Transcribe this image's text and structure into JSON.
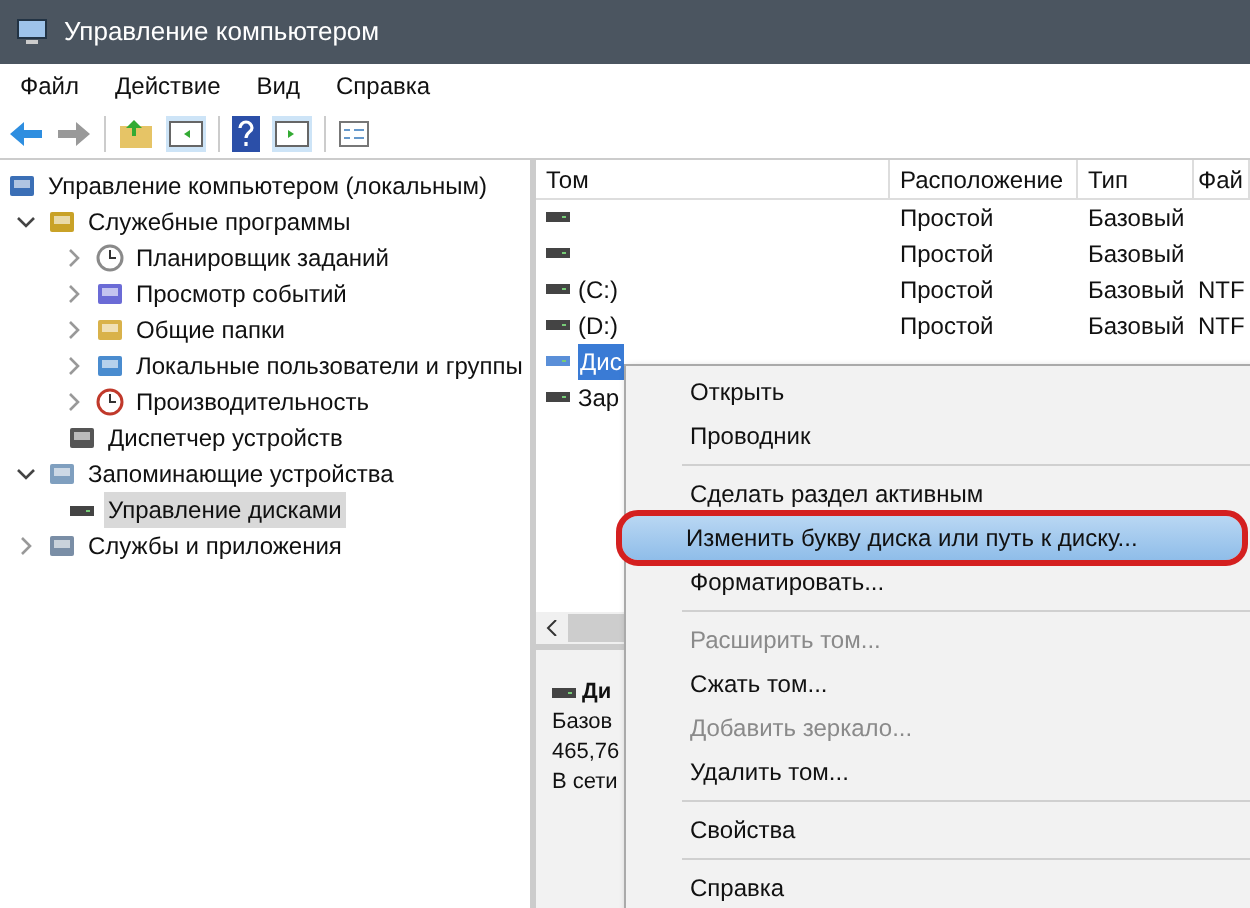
{
  "window": {
    "title": "Управление компьютером"
  },
  "menu": [
    "Файл",
    "Действие",
    "Вид",
    "Справка"
  ],
  "tree": [
    {
      "label": "Управление компьютером (локальным)",
      "selected": false,
      "children": [
        {
          "label": "Служебные программы",
          "selected": false,
          "expanded": true,
          "children": [
            {
              "label": "Планировщик заданий",
              "selected": false,
              "expanded": false
            },
            {
              "label": "Просмотр событий",
              "selected": false,
              "expanded": false
            },
            {
              "label": "Общие папки",
              "selected": false,
              "expanded": false
            },
            {
              "label": "Локальные пользователи и группы",
              "selected": false,
              "expanded": false
            },
            {
              "label": "Производительность",
              "selected": false,
              "expanded": false
            },
            {
              "label": "Диспетчер устройств",
              "selected": false
            }
          ]
        },
        {
          "label": "Запоминающие устройства",
          "selected": false,
          "expanded": true,
          "children": [
            {
              "label": "Управление дисками",
              "selected": true
            }
          ]
        },
        {
          "label": "Службы и приложения",
          "selected": false,
          "expanded": false
        }
      ]
    }
  ],
  "table": {
    "columns": [
      "Том",
      "Расположение",
      "Тип",
      "Фай"
    ],
    "rows": [
      {
        "cells": [
          "",
          "Простой",
          "Базовый",
          ""
        ],
        "selected": false
      },
      {
        "cells": [
          "",
          "Простой",
          "Базовый",
          ""
        ],
        "selected": false
      },
      {
        "cells": [
          "(C:)",
          "Простой",
          "Базовый",
          "NTF"
        ],
        "selected": false
      },
      {
        "cells": [
          "(D:)",
          "Простой",
          "Базовый",
          "NTF"
        ],
        "selected": false
      },
      {
        "cells": [
          "Дис",
          "",
          "",
          ""
        ],
        "selected": true
      },
      {
        "cells": [
          "Зар",
          "",
          "",
          ""
        ],
        "selected": false
      }
    ]
  },
  "disk_panel": {
    "name": "Ди",
    "lines": [
      "Базов",
      "465,76",
      "В сети"
    ]
  },
  "context_menu": [
    {
      "kind": "item",
      "label": "Открыть",
      "disabled": false,
      "highlighted": false
    },
    {
      "kind": "item",
      "label": "Проводник",
      "disabled": false,
      "highlighted": false
    },
    {
      "kind": "separator"
    },
    {
      "kind": "item",
      "label": "Сделать раздел активным",
      "disabled": false,
      "highlighted": false
    },
    {
      "kind": "item",
      "label": "Изменить букву диска или путь к диску...",
      "disabled": false,
      "highlighted": true
    },
    {
      "kind": "item",
      "label": "Форматировать...",
      "disabled": false,
      "highlighted": false
    },
    {
      "kind": "separator"
    },
    {
      "kind": "item",
      "label": "Расширить том...",
      "disabled": true,
      "highlighted": false
    },
    {
      "kind": "item",
      "label": "Сжать том...",
      "disabled": false,
      "highlighted": false
    },
    {
      "kind": "item",
      "label": "Добавить зеркало...",
      "disabled": true,
      "highlighted": false
    },
    {
      "kind": "item",
      "label": "Удалить том...",
      "disabled": false,
      "highlighted": false
    },
    {
      "kind": "separator"
    },
    {
      "kind": "item",
      "label": "Свойства",
      "disabled": false,
      "highlighted": false
    },
    {
      "kind": "separator"
    },
    {
      "kind": "item",
      "label": "Справка",
      "disabled": false,
      "highlighted": false
    }
  ]
}
